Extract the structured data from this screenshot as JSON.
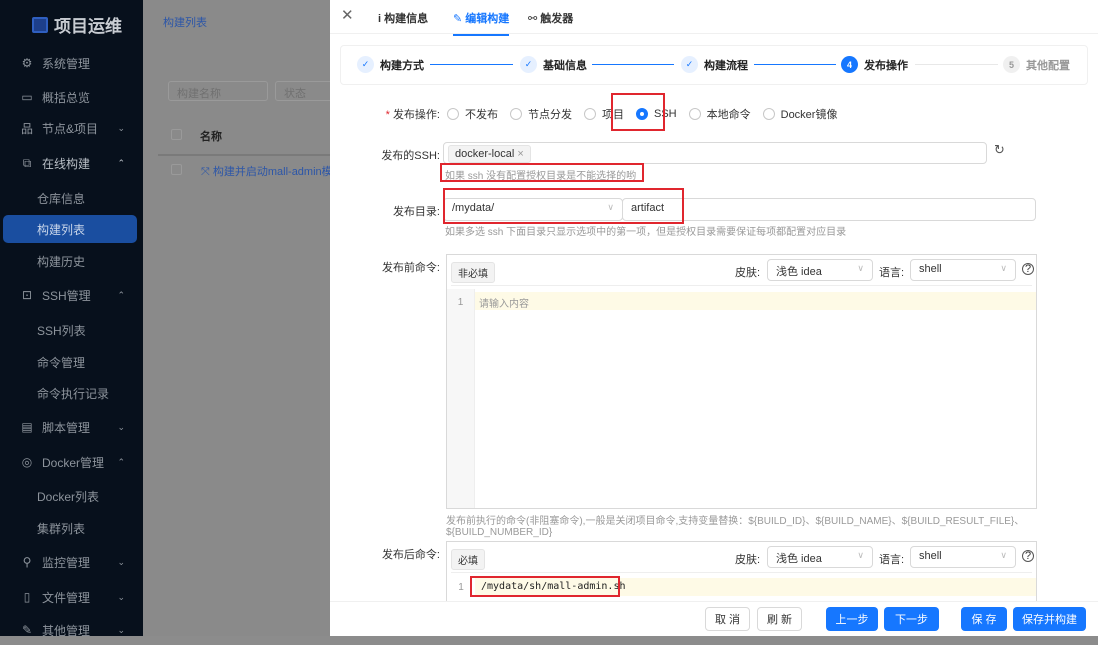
{
  "app": {
    "title": "项目运维"
  },
  "sidebar": {
    "items": [
      {
        "label": "系统管理",
        "icon": "gear-icon"
      },
      {
        "label": "概括总览",
        "icon": "monitor-icon"
      },
      {
        "label": "节点&项目",
        "icon": "cluster-icon"
      },
      {
        "label": "在线构建",
        "icon": "build-icon"
      },
      {
        "label": "仓库信息"
      },
      {
        "label": "构建列表"
      },
      {
        "label": "构建历史"
      },
      {
        "label": "SSH管理",
        "icon": "terminal-icon"
      },
      {
        "label": "SSH列表"
      },
      {
        "label": "命令管理"
      },
      {
        "label": "命令执行记录"
      },
      {
        "label": "脚本管理",
        "icon": "file-icon"
      },
      {
        "label": "Docker管理",
        "icon": "docker-icon"
      },
      {
        "label": "Docker列表"
      },
      {
        "label": "集群列表"
      },
      {
        "label": "监控管理",
        "icon": "monitor-search-icon"
      },
      {
        "label": "文件管理",
        "icon": "document-icon"
      },
      {
        "label": "其他管理",
        "icon": "tool-icon"
      }
    ]
  },
  "main": {
    "breadcrumb": "构建列表",
    "filter_name_placeholder": "构建名称",
    "filter_status_placeholder": "状态",
    "table_header_name": "名称",
    "row_name": "构建并启动mall-admin模"
  },
  "drawer": {
    "tabs": [
      "构建信息",
      "编辑构建",
      "触发器"
    ],
    "steps": [
      "构建方式",
      "基础信息",
      "构建流程",
      "发布操作",
      "其他配置"
    ],
    "step_numbers": [
      "4",
      "5"
    ],
    "publish_label": "发布操作:",
    "publish_options": [
      "不发布",
      "节点分发",
      "项目",
      "SSH",
      "本地命令",
      "Docker镜像"
    ],
    "publish_selected": "SSH",
    "ssh_label": "发布的SSH:",
    "ssh_tag": "docker-local",
    "ssh_hint": "如果 ssh 没有配置授权目录是不能选择的哟",
    "dir_label": "发布目录:",
    "dir_select": "/mydata/",
    "dir_input": "artifact",
    "dir_hint": "如果多选 ssh 下面目录只显示选项中的第一项，但是授权目录需要保证每项都配置对应目录",
    "pre_label": "发布前命令:",
    "pre_badge": "非必填",
    "skin_label": "皮肤:",
    "skin_value": "浅色 idea",
    "lang_label": "语言:",
    "lang_value": "shell",
    "pre_line": "1",
    "pre_placeholder": "请输入内容",
    "pre_hint1": "发布前执行的命令(非阻塞命令),一般是关闭项目命令,支持变量替换：${BUILD_ID}、${BUILD_NAME}、${BUILD_RESULT_FILE}、",
    "pre_hint2": "${BUILD_NUMBER_ID}",
    "post_label": "发布后命令:",
    "post_badge": "必填",
    "post_line": "1",
    "post_code": "/mydata/sh/mall-admin.sh"
  },
  "footer": {
    "cancel": "取 消",
    "refresh": "刷 新",
    "prev": "上一步",
    "next": "下一步",
    "save": "保 存",
    "save_build": "保存并构建"
  }
}
